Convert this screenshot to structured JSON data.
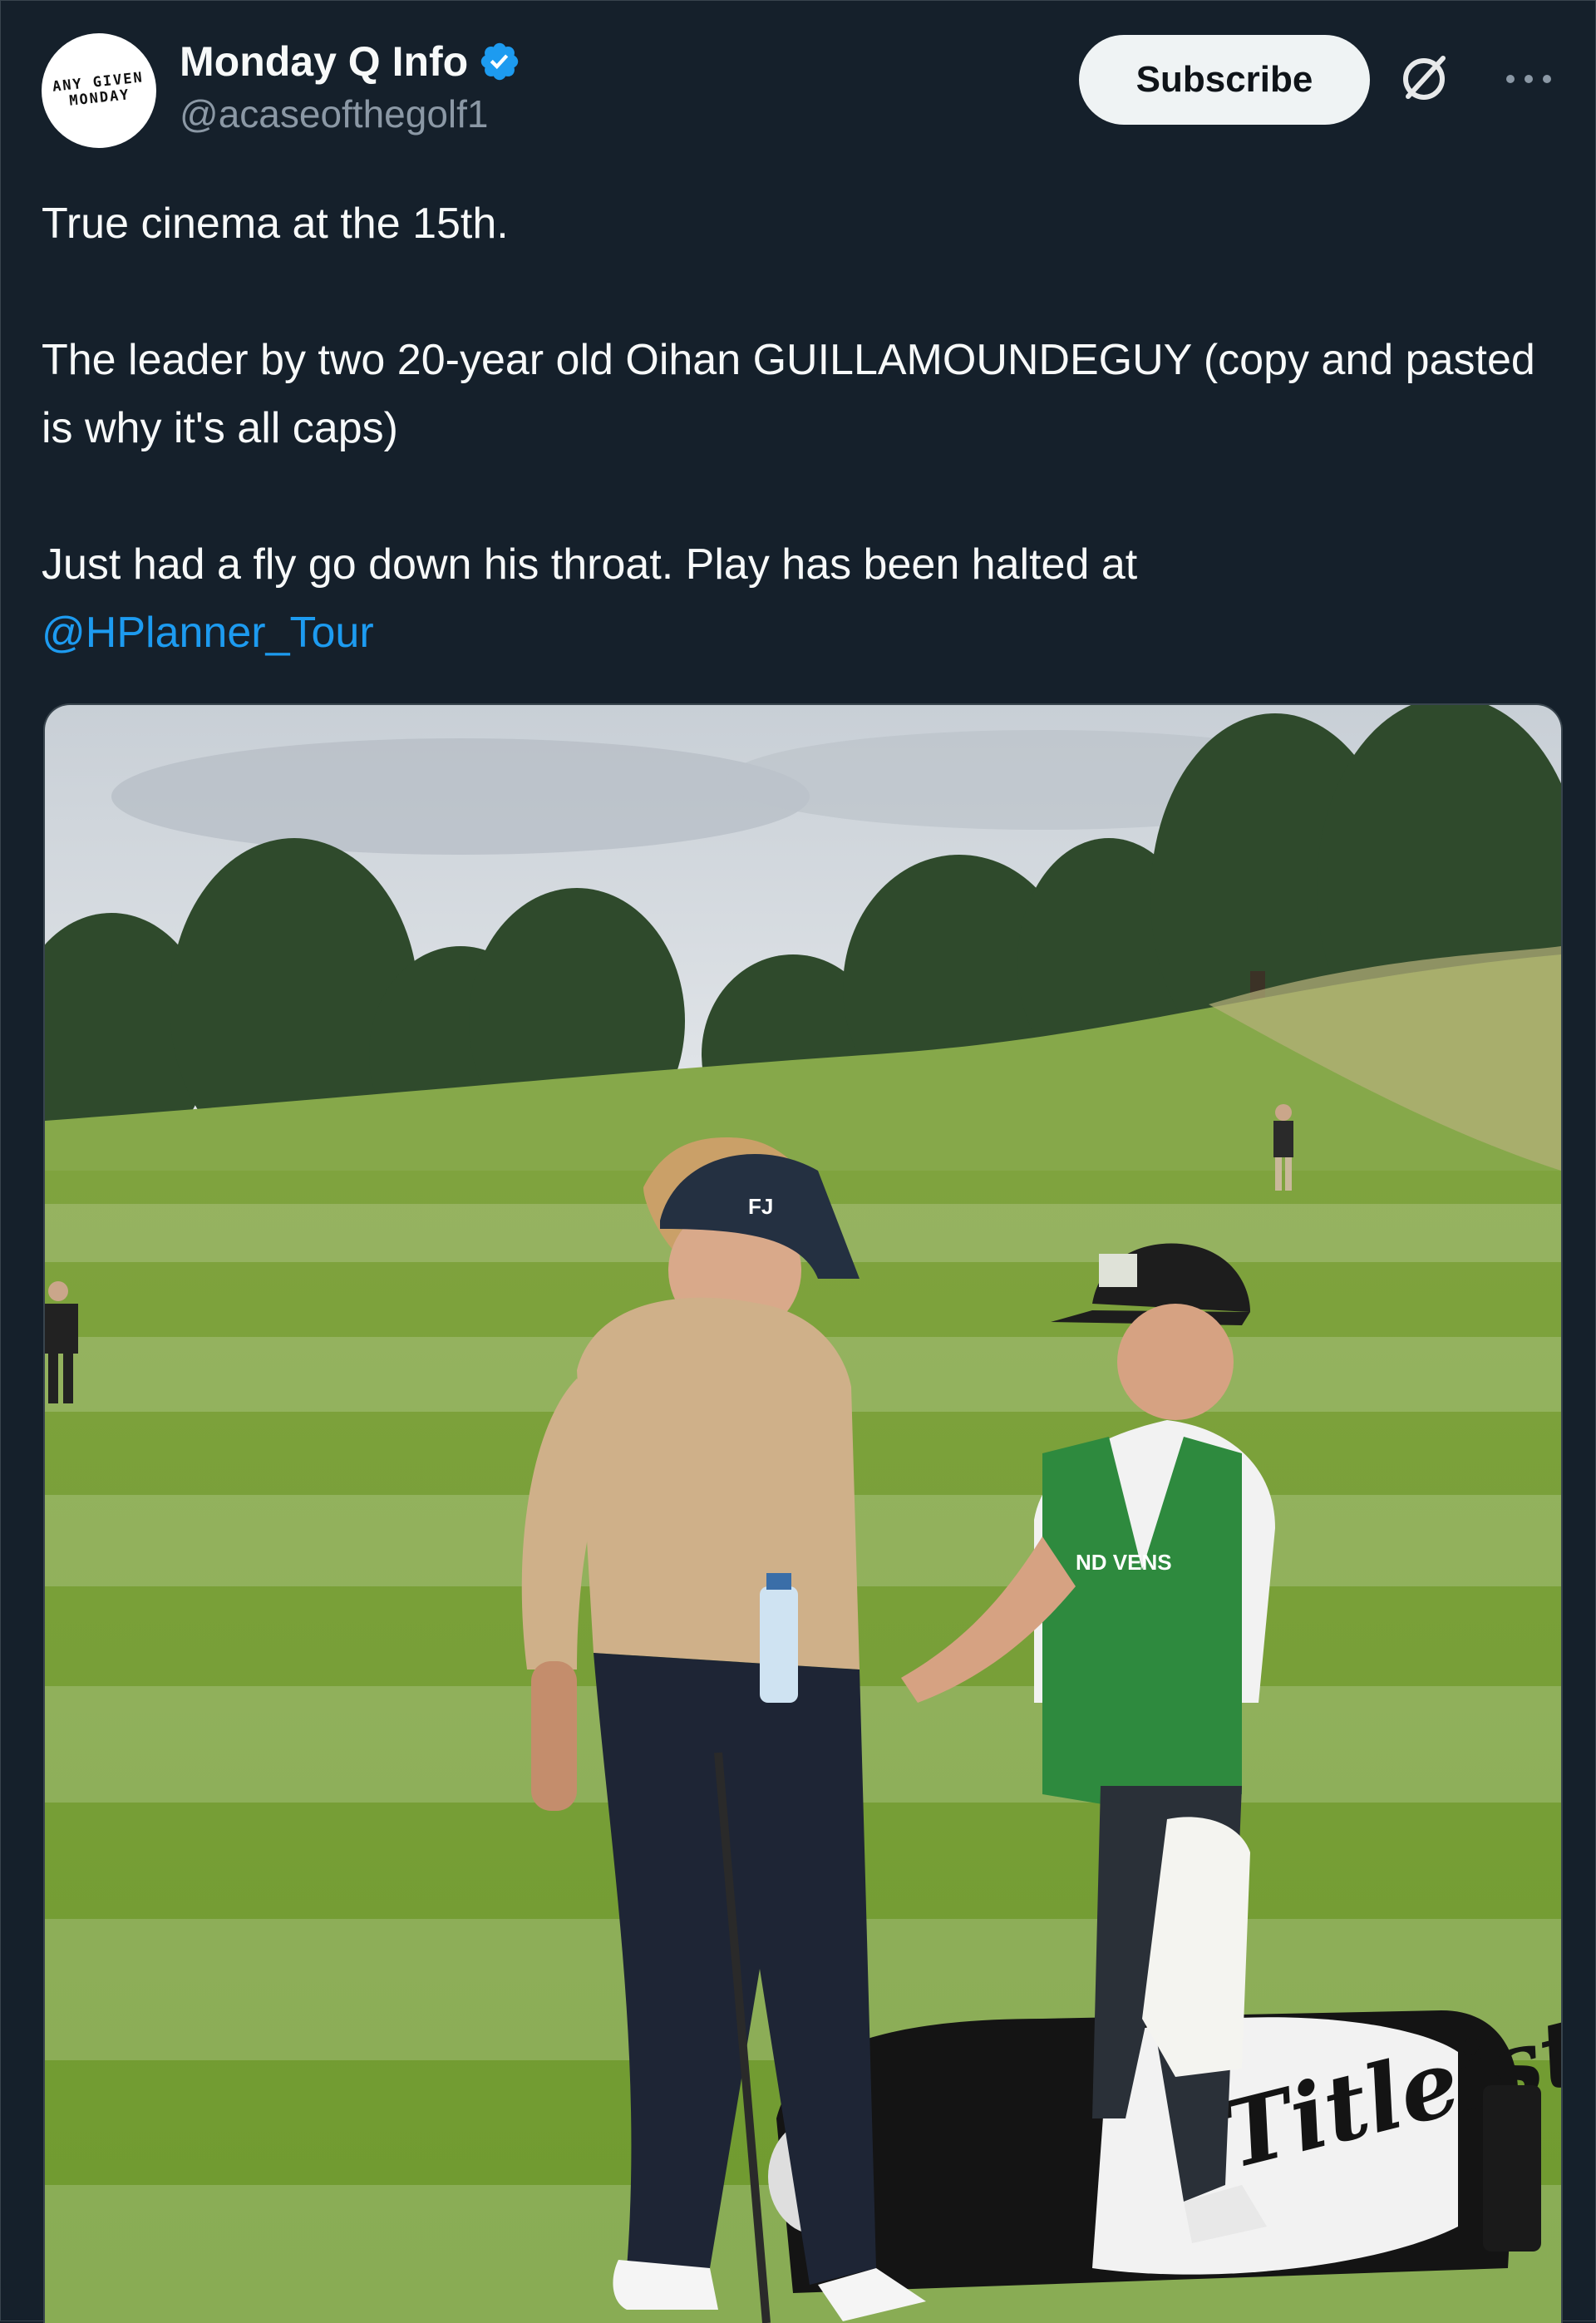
{
  "author": {
    "display_name": "Monday Q Info",
    "handle": "@acaseofthegolf1",
    "avatar_lines": [
      "ANY GIVEN",
      "MONDAY"
    ],
    "verified": true,
    "verified_color": "#1d9bf0"
  },
  "actions": {
    "subscribe_label": "Subscribe",
    "grok_icon": "grok-icon",
    "more_icon": "more-options-icon"
  },
  "tweet": {
    "line1": "True cinema at the 15th.",
    "line2": "The leader by two 20-year old Oihan GUILLAMOUNDEGUY (copy and pasted is why it's all caps)",
    "line3_prefix": "Just had a fly go down his throat. Play has been halted at",
    "mention": "@HPlanner_Tour"
  },
  "media": {
    "cap_text": "FJ",
    "brand_text": "Titleist",
    "bib_text": "ND VENS"
  },
  "colors": {
    "background": "#15202b",
    "link": "#1d9bf0",
    "secondary_text": "#8b98a5",
    "button_bg": "#eff3f4"
  }
}
